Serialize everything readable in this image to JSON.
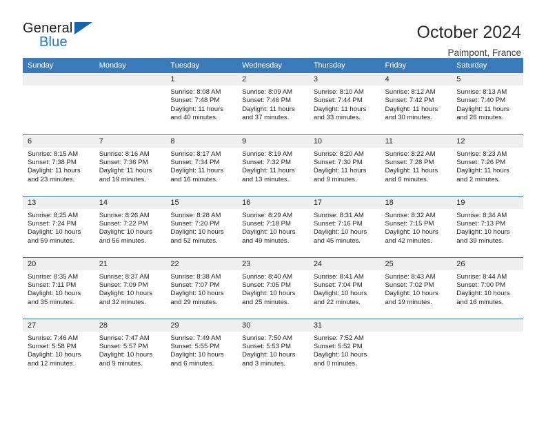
{
  "brand": {
    "name_top": "General",
    "name_bottom": "Blue",
    "triangle_color": "#1467ab",
    "blue_text_color": "#2079c4"
  },
  "header": {
    "title": "October 2024",
    "subtitle": "Paimpont, France"
  },
  "theme": {
    "header_bg": "#3b7ab8",
    "row_divider": "#2f73ad",
    "daynum_bg": "#efefef",
    "text": "#222222"
  },
  "calendar": {
    "weekday_headers": [
      "Sunday",
      "Monday",
      "Tuesday",
      "Wednesday",
      "Thursday",
      "Friday",
      "Saturday"
    ],
    "labels": {
      "sunrise": "Sunrise:",
      "sunset": "Sunset:",
      "daylight": "Daylight:"
    },
    "weeks": [
      [
        {
          "day": "",
          "empty": true
        },
        {
          "day": "",
          "empty": true
        },
        {
          "day": "1",
          "sunrise": "Sunrise: 8:08 AM",
          "sunset": "Sunset: 7:48 PM",
          "daylight_l1": "Daylight: 11 hours",
          "daylight_l2": "and 40 minutes."
        },
        {
          "day": "2",
          "sunrise": "Sunrise: 8:09 AM",
          "sunset": "Sunset: 7:46 PM",
          "daylight_l1": "Daylight: 11 hours",
          "daylight_l2": "and 37 minutes."
        },
        {
          "day": "3",
          "sunrise": "Sunrise: 8:10 AM",
          "sunset": "Sunset: 7:44 PM",
          "daylight_l1": "Daylight: 11 hours",
          "daylight_l2": "and 33 minutes."
        },
        {
          "day": "4",
          "sunrise": "Sunrise: 8:12 AM",
          "sunset": "Sunset: 7:42 PM",
          "daylight_l1": "Daylight: 11 hours",
          "daylight_l2": "and 30 minutes."
        },
        {
          "day": "5",
          "sunrise": "Sunrise: 8:13 AM",
          "sunset": "Sunset: 7:40 PM",
          "daylight_l1": "Daylight: 11 hours",
          "daylight_l2": "and 26 minutes."
        }
      ],
      [
        {
          "day": "6",
          "sunrise": "Sunrise: 8:15 AM",
          "sunset": "Sunset: 7:38 PM",
          "daylight_l1": "Daylight: 11 hours",
          "daylight_l2": "and 23 minutes."
        },
        {
          "day": "7",
          "sunrise": "Sunrise: 8:16 AM",
          "sunset": "Sunset: 7:36 PM",
          "daylight_l1": "Daylight: 11 hours",
          "daylight_l2": "and 19 minutes."
        },
        {
          "day": "8",
          "sunrise": "Sunrise: 8:17 AM",
          "sunset": "Sunset: 7:34 PM",
          "daylight_l1": "Daylight: 11 hours",
          "daylight_l2": "and 16 minutes."
        },
        {
          "day": "9",
          "sunrise": "Sunrise: 8:19 AM",
          "sunset": "Sunset: 7:32 PM",
          "daylight_l1": "Daylight: 11 hours",
          "daylight_l2": "and 13 minutes."
        },
        {
          "day": "10",
          "sunrise": "Sunrise: 8:20 AM",
          "sunset": "Sunset: 7:30 PM",
          "daylight_l1": "Daylight: 11 hours",
          "daylight_l2": "and 9 minutes."
        },
        {
          "day": "11",
          "sunrise": "Sunrise: 8:22 AM",
          "sunset": "Sunset: 7:28 PM",
          "daylight_l1": "Daylight: 11 hours",
          "daylight_l2": "and 6 minutes."
        },
        {
          "day": "12",
          "sunrise": "Sunrise: 8:23 AM",
          "sunset": "Sunset: 7:26 PM",
          "daylight_l1": "Daylight: 11 hours",
          "daylight_l2": "and 2 minutes."
        }
      ],
      [
        {
          "day": "13",
          "sunrise": "Sunrise: 8:25 AM",
          "sunset": "Sunset: 7:24 PM",
          "daylight_l1": "Daylight: 10 hours",
          "daylight_l2": "and 59 minutes."
        },
        {
          "day": "14",
          "sunrise": "Sunrise: 8:26 AM",
          "sunset": "Sunset: 7:22 PM",
          "daylight_l1": "Daylight: 10 hours",
          "daylight_l2": "and 56 minutes."
        },
        {
          "day": "15",
          "sunrise": "Sunrise: 8:28 AM",
          "sunset": "Sunset: 7:20 PM",
          "daylight_l1": "Daylight: 10 hours",
          "daylight_l2": "and 52 minutes."
        },
        {
          "day": "16",
          "sunrise": "Sunrise: 8:29 AM",
          "sunset": "Sunset: 7:18 PM",
          "daylight_l1": "Daylight: 10 hours",
          "daylight_l2": "and 49 minutes."
        },
        {
          "day": "17",
          "sunrise": "Sunrise: 8:31 AM",
          "sunset": "Sunset: 7:16 PM",
          "daylight_l1": "Daylight: 10 hours",
          "daylight_l2": "and 45 minutes."
        },
        {
          "day": "18",
          "sunrise": "Sunrise: 8:32 AM",
          "sunset": "Sunset: 7:15 PM",
          "daylight_l1": "Daylight: 10 hours",
          "daylight_l2": "and 42 minutes."
        },
        {
          "day": "19",
          "sunrise": "Sunrise: 8:34 AM",
          "sunset": "Sunset: 7:13 PM",
          "daylight_l1": "Daylight: 10 hours",
          "daylight_l2": "and 39 minutes."
        }
      ],
      [
        {
          "day": "20",
          "sunrise": "Sunrise: 8:35 AM",
          "sunset": "Sunset: 7:11 PM",
          "daylight_l1": "Daylight: 10 hours",
          "daylight_l2": "and 35 minutes."
        },
        {
          "day": "21",
          "sunrise": "Sunrise: 8:37 AM",
          "sunset": "Sunset: 7:09 PM",
          "daylight_l1": "Daylight: 10 hours",
          "daylight_l2": "and 32 minutes."
        },
        {
          "day": "22",
          "sunrise": "Sunrise: 8:38 AM",
          "sunset": "Sunset: 7:07 PM",
          "daylight_l1": "Daylight: 10 hours",
          "daylight_l2": "and 29 minutes."
        },
        {
          "day": "23",
          "sunrise": "Sunrise: 8:40 AM",
          "sunset": "Sunset: 7:05 PM",
          "daylight_l1": "Daylight: 10 hours",
          "daylight_l2": "and 25 minutes."
        },
        {
          "day": "24",
          "sunrise": "Sunrise: 8:41 AM",
          "sunset": "Sunset: 7:04 PM",
          "daylight_l1": "Daylight: 10 hours",
          "daylight_l2": "and 22 minutes."
        },
        {
          "day": "25",
          "sunrise": "Sunrise: 8:43 AM",
          "sunset": "Sunset: 7:02 PM",
          "daylight_l1": "Daylight: 10 hours",
          "daylight_l2": "and 19 minutes."
        },
        {
          "day": "26",
          "sunrise": "Sunrise: 8:44 AM",
          "sunset": "Sunset: 7:00 PM",
          "daylight_l1": "Daylight: 10 hours",
          "daylight_l2": "and 16 minutes."
        }
      ],
      [
        {
          "day": "27",
          "sunrise": "Sunrise: 7:46 AM",
          "sunset": "Sunset: 5:58 PM",
          "daylight_l1": "Daylight: 10 hours",
          "daylight_l2": "and 12 minutes."
        },
        {
          "day": "28",
          "sunrise": "Sunrise: 7:47 AM",
          "sunset": "Sunset: 5:57 PM",
          "daylight_l1": "Daylight: 10 hours",
          "daylight_l2": "and 9 minutes."
        },
        {
          "day": "29",
          "sunrise": "Sunrise: 7:49 AM",
          "sunset": "Sunset: 5:55 PM",
          "daylight_l1": "Daylight: 10 hours",
          "daylight_l2": "and 6 minutes."
        },
        {
          "day": "30",
          "sunrise": "Sunrise: 7:50 AM",
          "sunset": "Sunset: 5:53 PM",
          "daylight_l1": "Daylight: 10 hours",
          "daylight_l2": "and 3 minutes."
        },
        {
          "day": "31",
          "sunrise": "Sunrise: 7:52 AM",
          "sunset": "Sunset: 5:52 PM",
          "daylight_l1": "Daylight: 10 hours",
          "daylight_l2": "and 0 minutes."
        },
        {
          "day": "",
          "empty": true
        },
        {
          "day": "",
          "empty": true
        }
      ]
    ]
  }
}
